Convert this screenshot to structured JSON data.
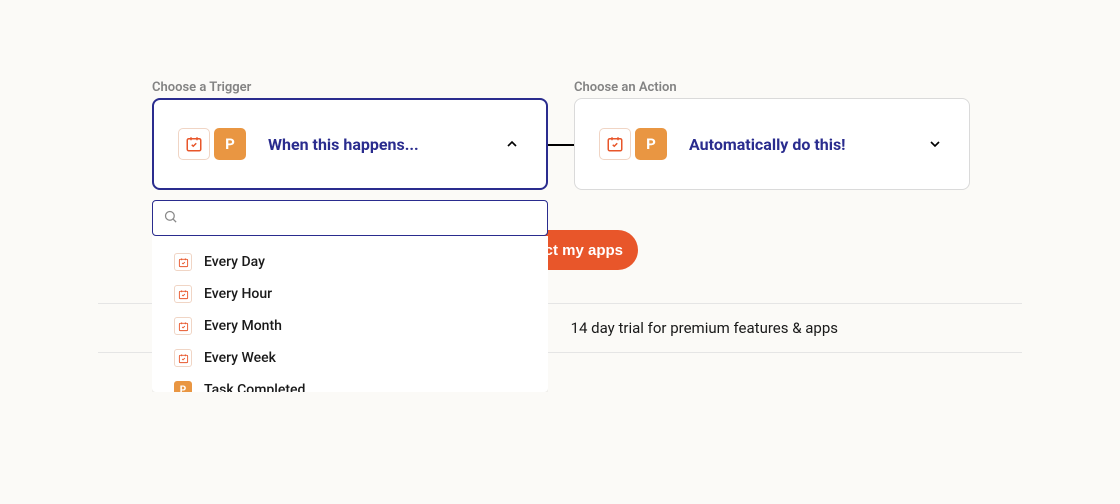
{
  "labels": {
    "trigger": "Choose a Trigger",
    "action": "Choose an Action"
  },
  "cards": {
    "trigger_text": "When this happens...",
    "action_text": "Automatically do this!"
  },
  "dropdown": {
    "options": [
      {
        "icon": "cal",
        "label": "Every Day"
      },
      {
        "icon": "cal",
        "label": "Every Hour"
      },
      {
        "icon": "cal",
        "label": "Every Month"
      },
      {
        "icon": "cal",
        "label": "Every Week"
      },
      {
        "icon": "p",
        "label": "Task Completed"
      }
    ]
  },
  "cta": "Connect my apps",
  "info": "14 day trial for premium features & apps"
}
